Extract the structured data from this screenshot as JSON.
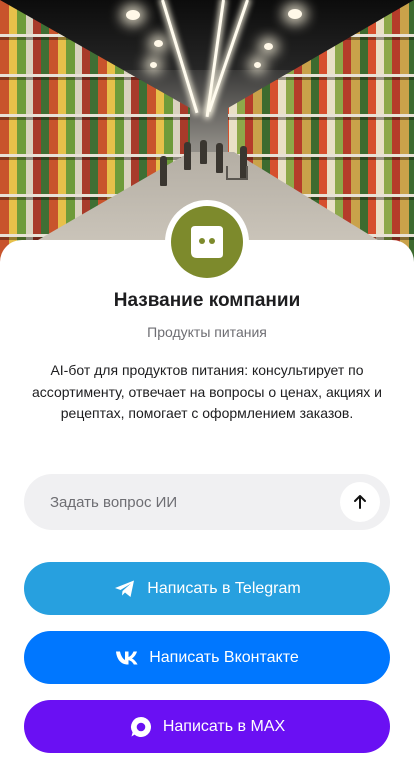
{
  "company": {
    "name": "Название компании",
    "category": "Продукты питания",
    "description": "AI-бот для продуктов питания: консультирует по ассортименту, отвечает на вопросы о ценах, акциях и рецептах, помогает с оформлением заказов."
  },
  "ask": {
    "placeholder": "Задать вопрос ИИ",
    "value": ""
  },
  "buttons": {
    "telegram": "Написать в Telegram",
    "vk": "Написать Вконтакте",
    "max": "Написать в MAX"
  },
  "colors": {
    "avatar": "#7d8a2c",
    "telegram": "#27a0df",
    "vk": "#0077ff",
    "max": "#6a10f3"
  },
  "icons": {
    "hero": "grocery-aisle-image",
    "avatar": "chat-bot-icon",
    "send": "arrow-up-icon",
    "telegram": "telegram-icon",
    "vk": "vk-icon",
    "max": "max-icon"
  }
}
